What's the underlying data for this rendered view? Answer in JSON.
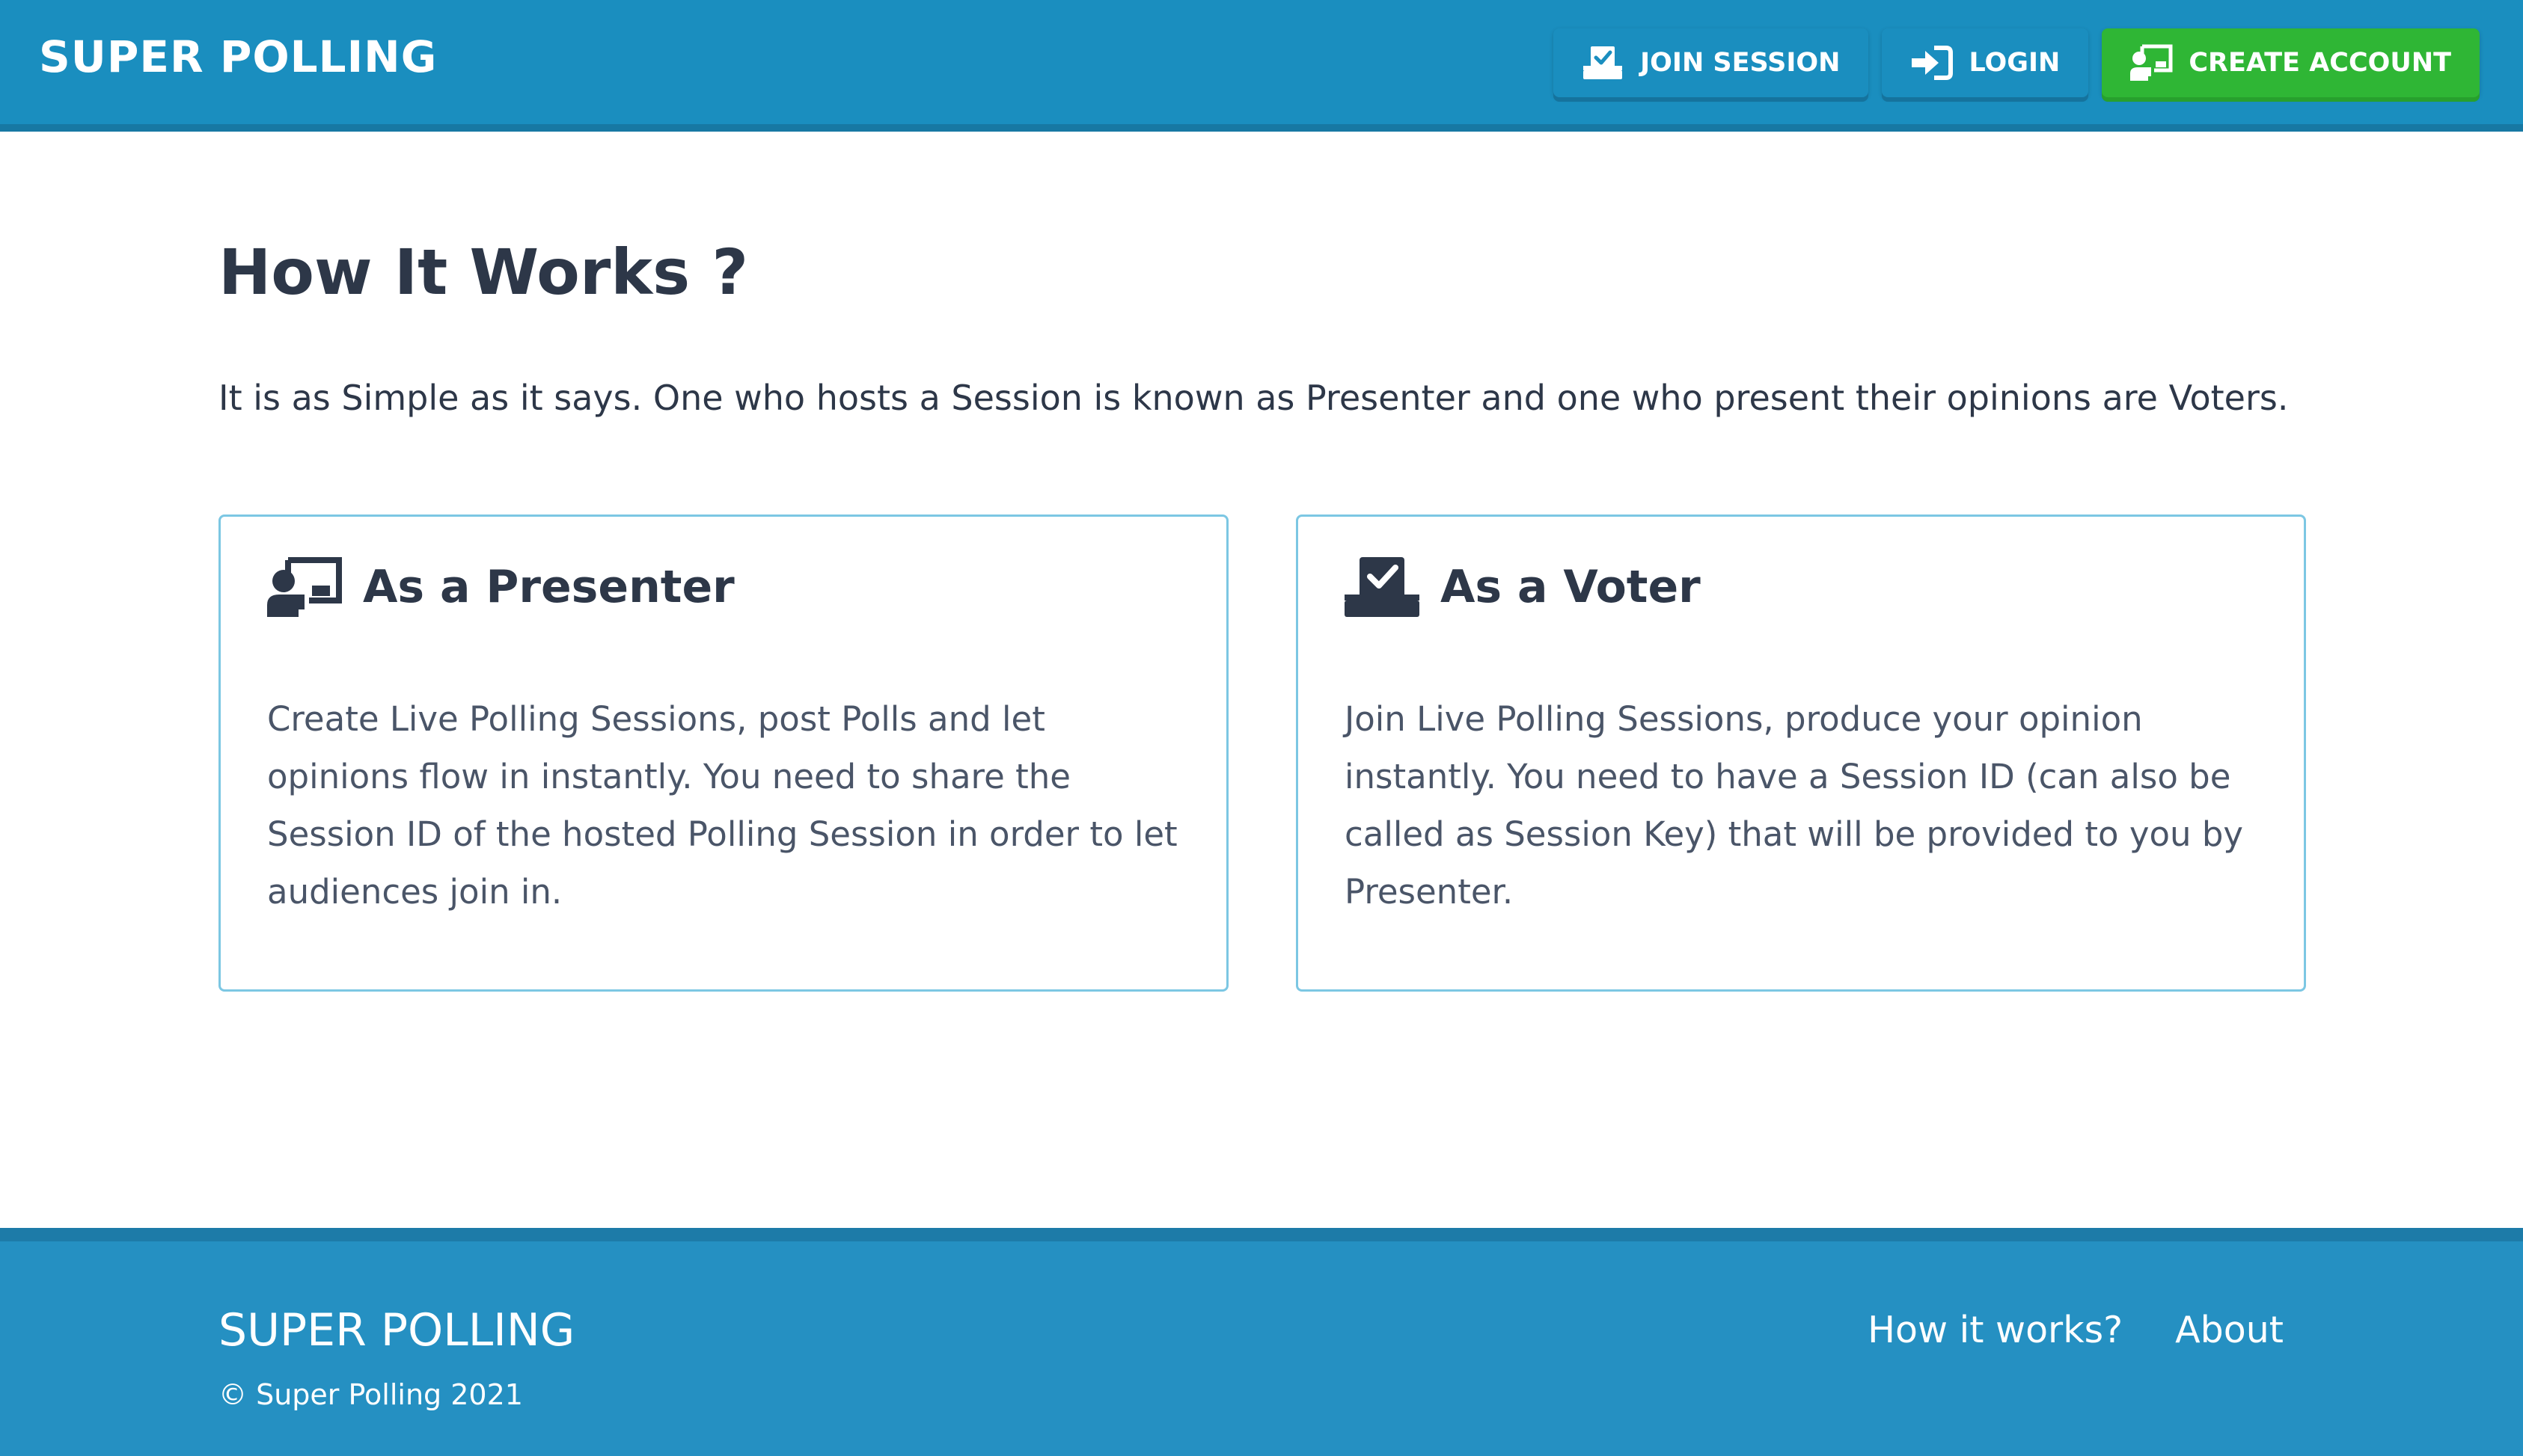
{
  "header": {
    "brand": "SUPER POLLING",
    "nav": [
      {
        "label": "JOIN SESSION",
        "icon": "vote-box-icon"
      },
      {
        "label": "LOGIN",
        "icon": "sign-in-icon"
      },
      {
        "label": "CREATE ACCOUNT",
        "icon": "presenter-icon"
      }
    ],
    "colors": {
      "bar": "#1a8ebf",
      "create_account": "#2fb635"
    }
  },
  "main": {
    "title": "How It Works ?",
    "intro": "It is as Simple as it says. One who hosts a Session is known as Presenter and one who present their opinions are Voters.",
    "cards": [
      {
        "title": "As a Presenter",
        "icon": "presenter-icon",
        "text": "Create Live Polling Sessions, post Polls and let opinions flow in instantly. You need to share the Session ID of the hosted Polling Session in order to let audiences join in."
      },
      {
        "title": "As a Voter",
        "icon": "vote-box-icon",
        "text": "Join Live Polling Sessions, produce your opinion instantly. You need to have a Session ID (can also be called as Session Key) that will be provided to you by Presenter."
      }
    ]
  },
  "footer": {
    "brand": "SUPER POLLING",
    "copyright": "© Super Polling 2021",
    "links": [
      {
        "label": "How it works?"
      },
      {
        "label": "About"
      }
    ],
    "color": "#2590c2"
  }
}
